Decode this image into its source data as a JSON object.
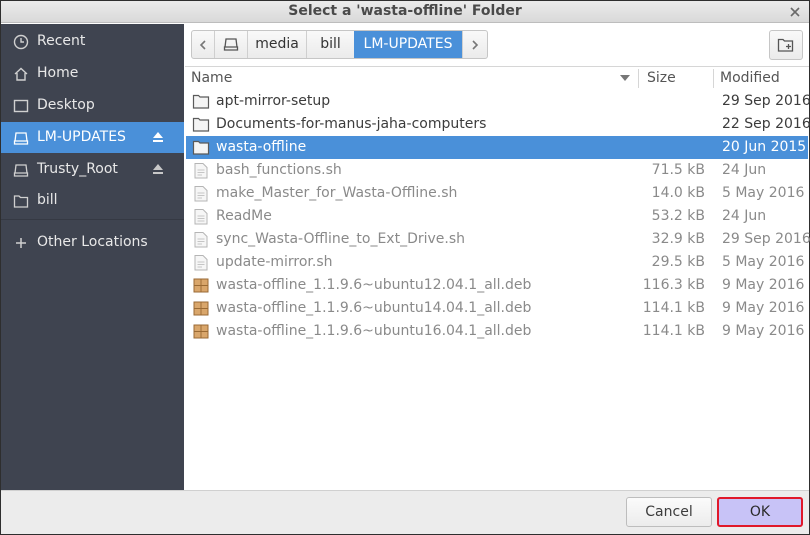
{
  "window": {
    "title": "Select a 'wasta-offline' Folder"
  },
  "sidebar": {
    "items": [
      {
        "label": "Recent",
        "icon": "clock-icon"
      },
      {
        "label": "Home",
        "icon": "home-icon"
      },
      {
        "label": "Desktop",
        "icon": "desktop-icon"
      },
      {
        "label": "LM-UPDATES",
        "icon": "drive-icon",
        "active": true,
        "ejectable": true
      },
      {
        "label": "Trusty_Root",
        "icon": "drive-icon",
        "ejectable": true
      },
      {
        "label": "bill",
        "icon": "folder-icon"
      },
      {
        "label": "Other Locations",
        "icon": "plus-icon"
      }
    ]
  },
  "pathbar": {
    "segments": [
      "media",
      "bill",
      "LM-UPDATES"
    ],
    "active": "LM-UPDATES"
  },
  "columns": {
    "name": "Name",
    "size": "Size",
    "modified": "Modified"
  },
  "files": [
    {
      "name": "apt-mirror-setup",
      "size": "",
      "modified": "29 Sep 2016",
      "type": "folder"
    },
    {
      "name": "Documents-for-manus-jaha-computers",
      "size": "",
      "modified": "22 Sep 2016",
      "type": "folder"
    },
    {
      "name": "wasta-offline",
      "size": "",
      "modified": "20 Jun 2015",
      "type": "folder",
      "selected": true
    },
    {
      "name": "bash_functions.sh",
      "size": "71.5 kB",
      "modified": "24 Jun",
      "type": "script"
    },
    {
      "name": "make_Master_for_Wasta-Offline.sh",
      "size": "14.0 kB",
      "modified": "5 May 2016",
      "type": "script"
    },
    {
      "name": "ReadMe",
      "size": "53.2 kB",
      "modified": "24 Jun",
      "type": "text"
    },
    {
      "name": "sync_Wasta-Offline_to_Ext_Drive.sh",
      "size": "32.9 kB",
      "modified": "29 Sep 2016",
      "type": "script"
    },
    {
      "name": "update-mirror.sh",
      "size": "29.5 kB",
      "modified": "5 May 2016",
      "type": "script"
    },
    {
      "name": "wasta-offline_1.1.9.6~ubuntu12.04.1_all.deb",
      "size": "116.3 kB",
      "modified": "9 May 2016",
      "type": "package"
    },
    {
      "name": "wasta-offline_1.1.9.6~ubuntu14.04.1_all.deb",
      "size": "114.1 kB",
      "modified": "9 May 2016",
      "type": "package"
    },
    {
      "name": "wasta-offline_1.1.9.6~ubuntu16.04.1_all.deb",
      "size": "114.1 kB",
      "modified": "9 May 2016",
      "type": "package"
    }
  ],
  "buttons": {
    "cancel": "Cancel",
    "ok": "OK"
  },
  "colors": {
    "accent": "#4a90d9",
    "sidebar_bg": "#3f4450",
    "ok_highlight_border": "#e0182a",
    "ok_bg": "#c8c3f7"
  }
}
